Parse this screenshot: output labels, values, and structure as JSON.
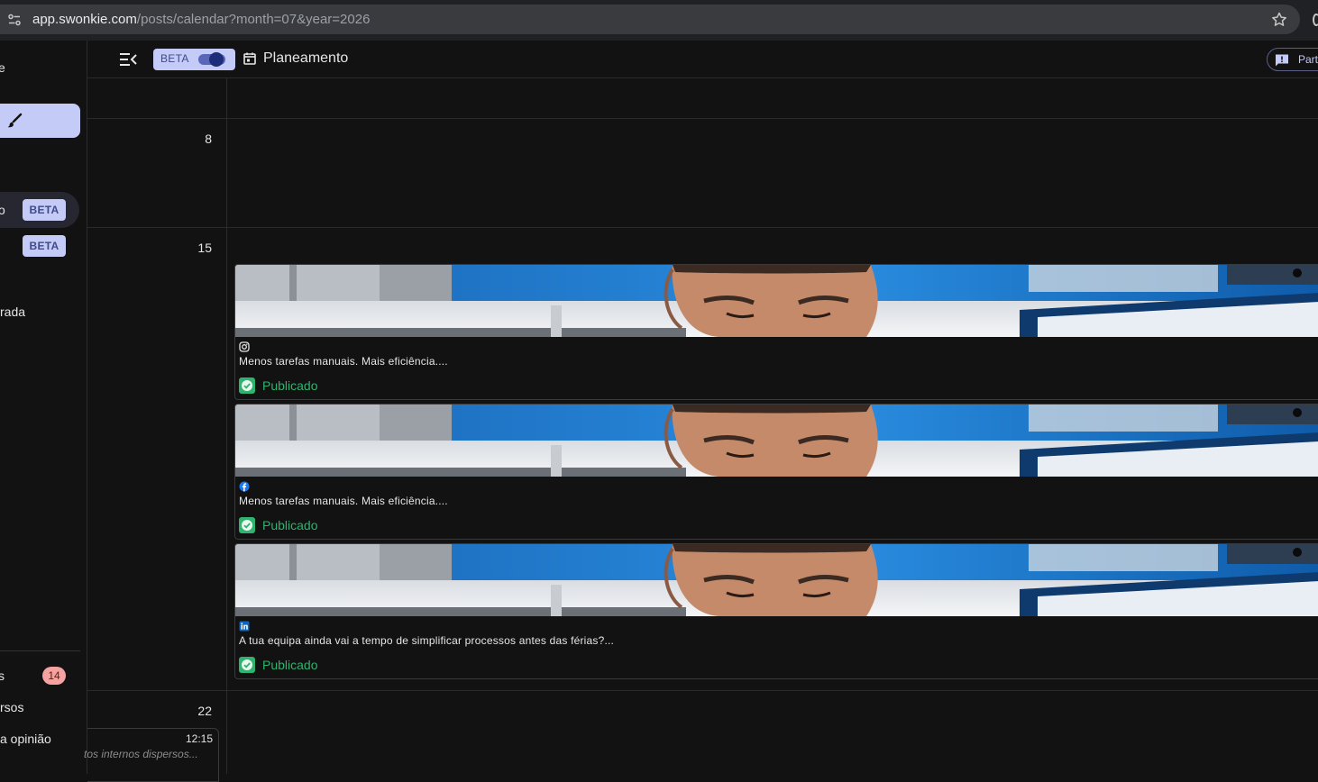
{
  "browser": {
    "url_host": "app.swonkie.com",
    "url_path": "/posts/calendar?month=07&year=2026"
  },
  "sidebar": {
    "frag_top": "e",
    "item_beta_1": "BETA",
    "item_beta_2": "BETA",
    "frag_active": "o",
    "frag_rada": "rada",
    "frag_s": "s",
    "notification_count": "14",
    "frag_rsos": "rsos",
    "frag_opiniao": "a opinião"
  },
  "topbar": {
    "beta_label": "BETA",
    "beta_enabled": true,
    "page_title": "Planeamento",
    "feedback_label": "Part"
  },
  "calendar": {
    "weeks": [
      {
        "day": ""
      },
      {
        "day": "8"
      },
      {
        "day": "15"
      },
      {
        "day": "22"
      }
    ],
    "posts": [
      {
        "network": "instagram-icon",
        "text": "Menos tarefas manuais. Mais eficiência....",
        "status": "Publicado"
      },
      {
        "network": "facebook-icon",
        "text": "Menos tarefas manuais. Mais eficiência....",
        "status": "Publicado"
      },
      {
        "network": "linkedin-icon",
        "text": "A tua equipa ainda vai a tempo de simplificar processos antes das férias?...",
        "status": "Publicado"
      }
    ],
    "mini_post": {
      "time": "12:15",
      "text": "tos internos dispersos..."
    }
  },
  "colors": {
    "accent": "#c5cbf7",
    "status_published": "#2fb36f",
    "background": "#121212"
  }
}
